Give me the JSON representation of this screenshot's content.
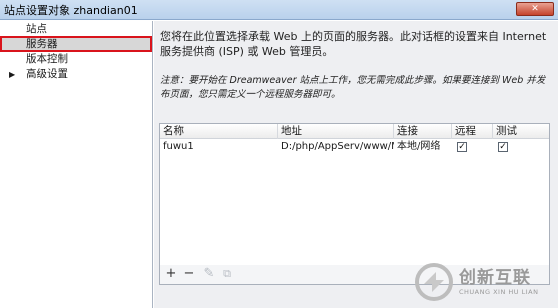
{
  "window": {
    "title": "站点设置对象 zhandian01",
    "close_label": "✕"
  },
  "nav": {
    "items": [
      {
        "label": "站点"
      },
      {
        "label": "服务器"
      },
      {
        "label": "版本控制"
      },
      {
        "label": "高级设置",
        "arrow": "▶"
      }
    ]
  },
  "content": {
    "description": "您将在此位置选择承载 Web 上的页面的服务器。此对话框的设置来自 Internet 服务提供商 (ISP) 或 Web 管理员。",
    "note": "注意：要开始在 Dreamweaver 站点上工作，您无需完成此步骤。如果要连接到 Web 并发布页面，您只需定义一个远程服务器即可。"
  },
  "table": {
    "headers": [
      "名称",
      "地址",
      "连接",
      "远程",
      "测试"
    ],
    "rows": [
      {
        "name": "fuwu1",
        "address": "D:/php/AppServ/www/M...",
        "connection": "本地/网络",
        "remote": true,
        "test": true
      }
    ]
  },
  "toolbar": {
    "add": "+",
    "remove": "−",
    "edit": "✎",
    "duplicate": "⧉"
  },
  "watermark": {
    "brand": "创新互联",
    "sub": "CHUANG XIN HU LIAN"
  }
}
